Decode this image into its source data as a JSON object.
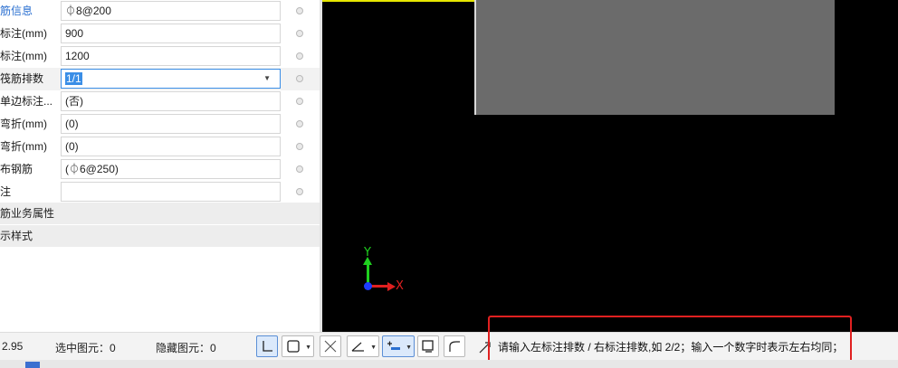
{
  "properties": {
    "rows": [
      {
        "name": "筋信息",
        "value": "⏀8@200",
        "blue": true
      },
      {
        "name": "标注(mm)",
        "value": "900"
      },
      {
        "name": "标注(mm)",
        "value": "1200"
      },
      {
        "name": "筏筋排数",
        "value": "1/1",
        "active": true
      },
      {
        "name": "单边标注...",
        "value": "(否)"
      },
      {
        "name": "弯折(mm)",
        "value": "(0)"
      },
      {
        "name": "弯折(mm)",
        "value": "(0)"
      },
      {
        "name": "布钢筋",
        "value": "(⏀6@250)"
      },
      {
        "name": "注",
        "value": ""
      }
    ],
    "groups": [
      "筋业务属性",
      "示样式"
    ]
  },
  "canvas": {
    "axis_y_label": "Y",
    "axis_x_label": "X",
    "colors": {
      "background": "#000000",
      "top_line": "#e6e600",
      "slab": "#6b6b6b",
      "y_axis": "#1fd01f",
      "x_axis": "#e02020"
    }
  },
  "status": {
    "coord": "2.95",
    "selected": "选中图元：0",
    "hidden": "隐藏图元：0",
    "command_prompt": "请输入左标注排数 / 右标注排数,如 2/2；输入一个数字时表示左右均同；"
  }
}
